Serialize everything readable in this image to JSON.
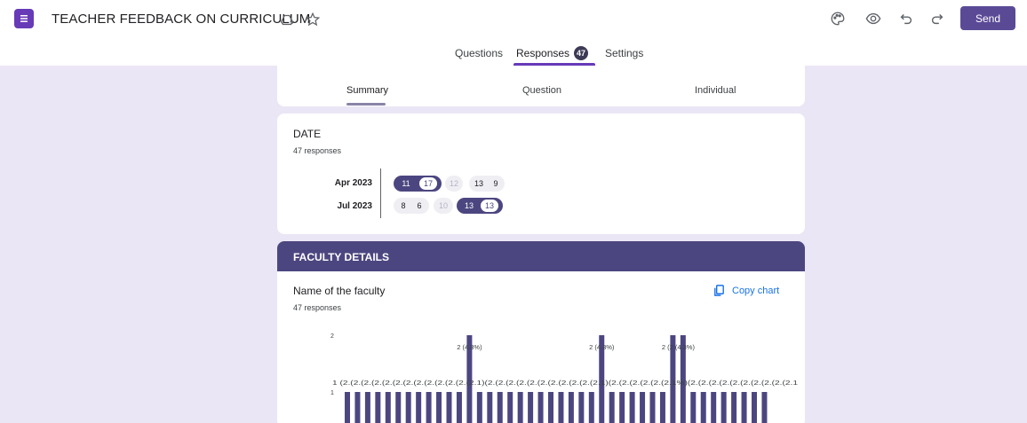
{
  "header": {
    "doc_title": "TEACHER FEEDBACK ON CURRICULUM",
    "send_label": "Send",
    "accent": "#673ab7",
    "icons": [
      "forms-app-icon",
      "add-drive-icon",
      "star-icon",
      "palette-icon",
      "preview-eye-icon",
      "undo-icon",
      "redo-icon"
    ]
  },
  "tabs": {
    "questions": "Questions",
    "responses": "Responses",
    "responses_count": "47",
    "settings": "Settings"
  },
  "summary_tabs": {
    "summary": "Summary",
    "question": "Question",
    "individual": "Individual"
  },
  "date_question": {
    "title": "DATE",
    "count": "47 responses",
    "months": [
      {
        "label": "Apr 2023",
        "days": [
          "11",
          "17",
          "12",
          "13",
          "9"
        ]
      },
      {
        "label": "Jul 2023",
        "days": [
          "8",
          "6",
          "10",
          "13",
          "13"
        ]
      }
    ]
  },
  "faculty_section": {
    "header": "FACULTY DETAILS",
    "question": "Name of the faculty",
    "count": "47 responses",
    "copy_chart": "Copy chart"
  },
  "chart_data": {
    "type": "bar",
    "title": "",
    "ylim": [
      0,
      2
    ],
    "ytick_labels": [
      "1",
      "2"
    ],
    "bar_count": 42,
    "values": [
      1,
      1,
      1,
      1,
      1,
      1,
      1,
      1,
      1,
      1,
      1,
      1,
      2,
      1,
      1,
      1,
      1,
      1,
      1,
      1,
      1,
      1,
      1,
      1,
      1,
      2,
      1,
      1,
      1,
      1,
      1,
      1,
      2,
      2,
      1,
      1,
      1,
      1,
      1,
      1,
      1,
      1
    ],
    "labels_top": [
      "2 (4.3%)",
      "2 (4.3%)",
      "2 (2 (4.3%)"
    ],
    "value_label_row": "1 (2.(2.(2.(2.(2.(2.(2.(2.(2.(2.(2.(2.(2.1)(2.(2.(2.(2.(2.(2.(2.(2.(2.(2.(2.1)(2.(2.(2.(2.(2.(2.1%)(2.(2.(2.(2.(2.(2.(2.(2.(2.(2.1",
    "bar_color": "#4c4680"
  }
}
